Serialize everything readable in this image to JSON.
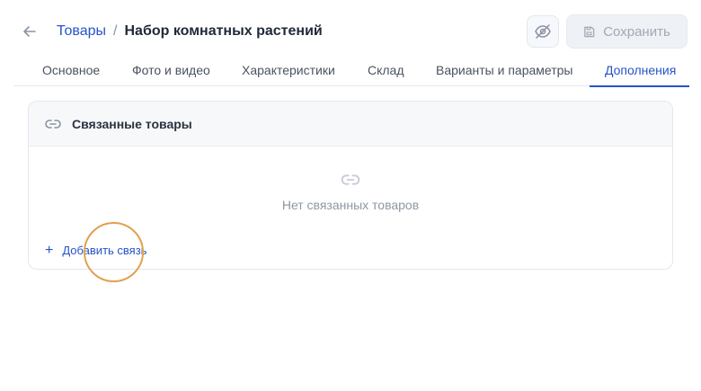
{
  "header": {
    "back_icon": "arrow-left-icon",
    "breadcrumb_parent": "Товары",
    "breadcrumb_separator": "/",
    "breadcrumb_current": "Набор комнатных растений",
    "visibility_icon": "eye-off-icon",
    "save_icon": "floppy-disk-icon",
    "save_label": "Сохранить"
  },
  "tabs": [
    {
      "label": "Основное",
      "active": false
    },
    {
      "label": "Фото и видео",
      "active": false
    },
    {
      "label": "Характеристики",
      "active": false
    },
    {
      "label": "Склад",
      "active": false
    },
    {
      "label": "Варианты и параметры",
      "active": false
    },
    {
      "label": "Дополнения",
      "active": true
    }
  ],
  "related_card": {
    "icon": "link-icon",
    "title": "Связанные товары",
    "empty_icon": "link-icon",
    "empty_text": "Нет связанных товаров",
    "add_icon": "plus-icon",
    "add_label": "Добавить связь"
  },
  "colors": {
    "accent": "#2554c7",
    "muted_text": "#8e97a4",
    "cursor_highlight": "#e3a04f"
  }
}
